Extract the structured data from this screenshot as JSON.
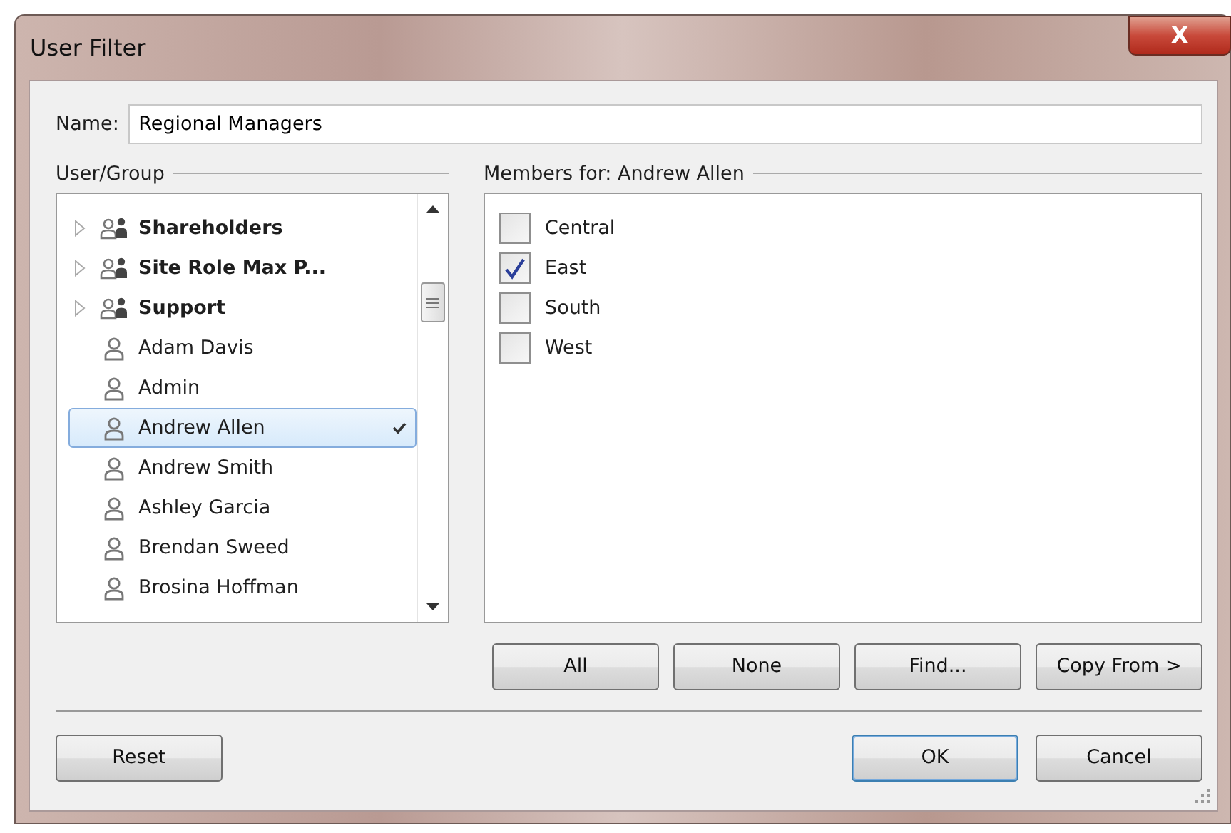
{
  "window": {
    "title": "User Filter",
    "close": "X"
  },
  "name_field": {
    "label": "Name:",
    "value": "Regional Managers"
  },
  "user_group": {
    "label": "User/Group",
    "items": [
      {
        "kind": "group",
        "label": "Shareholders",
        "selected": false,
        "checked": false
      },
      {
        "kind": "group",
        "label": "Site Role Max P...",
        "selected": false,
        "checked": false
      },
      {
        "kind": "group",
        "label": "Support",
        "selected": false,
        "checked": false
      },
      {
        "kind": "user",
        "label": "Adam Davis",
        "selected": false,
        "checked": false
      },
      {
        "kind": "user",
        "label": "Admin",
        "selected": false,
        "checked": false
      },
      {
        "kind": "user",
        "label": "Andrew Allen",
        "selected": true,
        "checked": true
      },
      {
        "kind": "user",
        "label": "Andrew Smith",
        "selected": false,
        "checked": false
      },
      {
        "kind": "user",
        "label": "Ashley Garcia",
        "selected": false,
        "checked": false
      },
      {
        "kind": "user",
        "label": "Brendan Sweed",
        "selected": false,
        "checked": false
      },
      {
        "kind": "user",
        "label": "Brosina Hoffman",
        "selected": false,
        "checked": false
      }
    ]
  },
  "members": {
    "label": "Members for: Andrew Allen",
    "items": [
      {
        "label": "Central",
        "checked": false
      },
      {
        "label": "East",
        "checked": true
      },
      {
        "label": "South",
        "checked": false
      },
      {
        "label": "West",
        "checked": false
      }
    ],
    "buttons": [
      "All",
      "None",
      "Find...",
      "Copy From >"
    ]
  },
  "footer": {
    "left_buttons": [
      "Reset"
    ],
    "right_buttons": [
      {
        "label": "OK",
        "default": true
      },
      {
        "label": "Cancel",
        "default": false
      }
    ]
  }
}
